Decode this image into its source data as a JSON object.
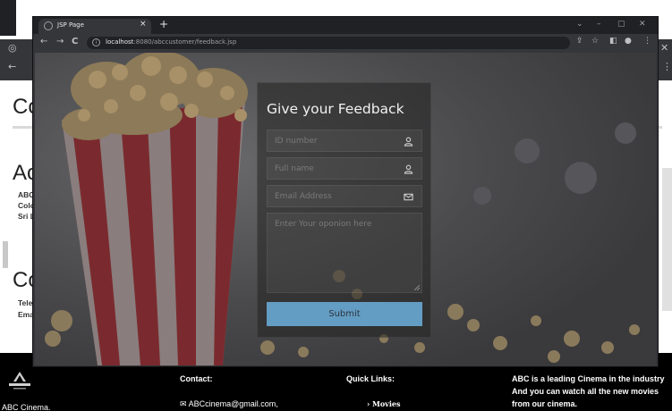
{
  "browser": {
    "tab_title": "JSP Page",
    "tab_close": "×",
    "new_tab": "+",
    "win_minimize": "–",
    "win_maximize": "▢",
    "win_close": "✕",
    "win_menu": "⌄",
    "back": "←",
    "forward": "→",
    "reload": "C",
    "url_host": "localhost",
    "url_path": ":8080/abccustomer/feedback.jsp",
    "menu_dots": "⋮"
  },
  "form": {
    "title": "Give your Feedback",
    "id_placeholder": "ID number",
    "name_placeholder": "Full name",
    "email_placeholder": "Email Address",
    "opinion_placeholder": "Enter Your oponion here",
    "submit_label": "Submit",
    "icons": {
      "id": "user-icon",
      "name": "user-icon",
      "email": "envelope-icon"
    }
  },
  "background_page": {
    "headings": [
      "Co",
      "Ac",
      "Co"
    ],
    "address_lines": [
      "ABC",
      "Colo",
      "Sri L"
    ],
    "contact_lines": [
      "Tele",
      "Ema"
    ]
  },
  "footer": {
    "brand": "ABC Cinema.",
    "logo_text": "ABC CINEMA",
    "contact_heading": "Contact:",
    "email": "ABCcinema@gmail.com,",
    "quick_links_heading": "Quick Links:",
    "movies_link": "› Movies",
    "about_lines": [
      "ABC is a leading Cinema in the industry",
      "And you can watch all the new movies",
      "from our cinema."
    ]
  },
  "colors": {
    "submit": "#6aa9d3",
    "chrome_dark": "#202124",
    "chrome_toolbar": "#35363a",
    "footer": "#000000"
  }
}
